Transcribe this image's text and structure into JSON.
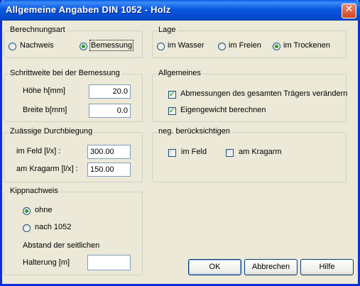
{
  "window": {
    "title": "Allgemeine Angaben DIN 1052 - Holz",
    "close_symbol": "✕"
  },
  "berechnungsart": {
    "legend": "Berechnungsart",
    "options": [
      {
        "label": "Nachweis",
        "selected": false
      },
      {
        "label": "Bemessung",
        "selected": true
      }
    ]
  },
  "lage": {
    "legend": "Lage",
    "options": [
      {
        "label": "im Wasser",
        "selected": false
      },
      {
        "label": "im Freien",
        "selected": false
      },
      {
        "label": "im Trockenen",
        "selected": true
      }
    ]
  },
  "schrittweite": {
    "legend": "Schrittweite bei der Bemessung",
    "hoehe_label": "Höhe h[mm]",
    "hoehe_value": "20.0",
    "breite_label": "Breite b[mm]",
    "breite_value": "0.0"
  },
  "allgemeines": {
    "legend": "Allgemeines",
    "items": [
      {
        "label": "Abmessungen des gesamten Trägers verändern",
        "checked": true
      },
      {
        "label": "Eigengewicht berechnen",
        "checked": true
      }
    ]
  },
  "durchbiegung": {
    "legend": "Zuässige Durchbiegung",
    "feld_label": "im Feld [l/x] :",
    "feld_value": "300.00",
    "kragarm_label": "am Kragarm [l/x] :",
    "kragarm_value": "150.00"
  },
  "neg": {
    "legend": "neg. berücksichtigen",
    "items": [
      {
        "label": "im Feld",
        "checked": false
      },
      {
        "label": "am Kragarm",
        "checked": false
      }
    ]
  },
  "kipp": {
    "legend": "Kippnachweis",
    "options": [
      {
        "label": "ohne",
        "selected": true
      },
      {
        "label": "nach 1052",
        "selected": false
      }
    ],
    "abstand_label": "Abstand der seitlichen",
    "halterung_label": "Halterung [m]",
    "halterung_value": ""
  },
  "buttons": {
    "ok": "OK",
    "abbrechen": "Abbrechen",
    "hilfe": "Hilfe"
  }
}
